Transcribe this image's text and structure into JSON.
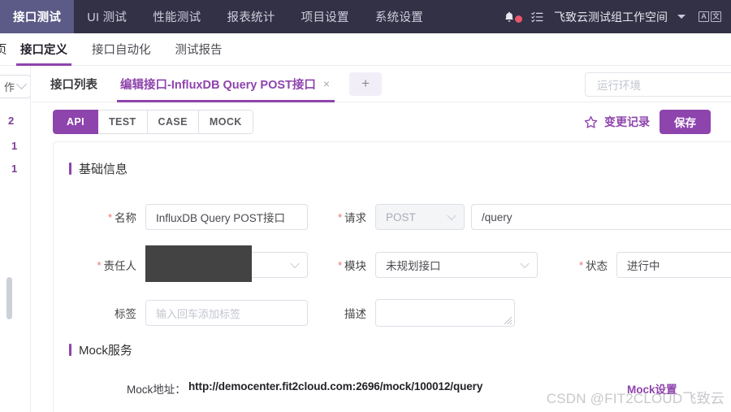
{
  "topbar": {
    "nav": [
      {
        "label": "接口测试",
        "active": true
      },
      {
        "label": "UI 测试",
        "active": false
      },
      {
        "label": "性能测试",
        "active": false
      },
      {
        "label": "报表统计",
        "active": false
      },
      {
        "label": "项目设置",
        "active": false
      },
      {
        "label": "系统设置",
        "active": false
      }
    ],
    "bell_icon": "bell-icon",
    "notification_dot": true,
    "tasklist_icon": "task-list-icon",
    "workspace": "飞致云测试组工作空间",
    "workspace_caret": "chevron-down-icon",
    "lang_toggle": [
      "A",
      "文"
    ]
  },
  "subnav": {
    "clipped_prefix": "页",
    "items": [
      {
        "label": "接口定义",
        "active": true
      },
      {
        "label": "接口自动化",
        "active": false
      },
      {
        "label": "测试报告",
        "active": false
      }
    ]
  },
  "sidebar": {
    "select_text": "作",
    "counts": [
      "2",
      "1",
      "1"
    ]
  },
  "tabs": {
    "items": [
      {
        "label": "接口列表",
        "active": false,
        "closable": false
      },
      {
        "label": "编辑接口-InfluxDB Query POST接口",
        "active": true,
        "closable": true
      }
    ],
    "close_glyph": "×",
    "add_label": "+",
    "add_icon": "plus-icon"
  },
  "environment": {
    "placeholder": "运行环境",
    "value": ""
  },
  "modes": {
    "items": [
      {
        "label": "API",
        "active": true
      },
      {
        "label": "TEST",
        "active": false
      },
      {
        "label": "CASE",
        "active": false
      },
      {
        "label": "MOCK",
        "active": false
      }
    ]
  },
  "actions": {
    "star_icon": "star-outline-icon",
    "changelog_label": "变更记录",
    "save_label": "保存"
  },
  "basic_info": {
    "title": "基础信息",
    "name_label": "名称",
    "name_value": "InfluxDB Query POST接口",
    "method_label": "请求",
    "method_value": "POST",
    "path_value": "/query",
    "owner_label": "责任人",
    "owner_value": "",
    "owner_redacted": true,
    "module_label": "模块",
    "module_value": "未规划接口",
    "status_label": "状态",
    "status_value": "进行中",
    "tag_label": "标签",
    "tag_placeholder": "输入回车添加标签",
    "desc_label": "描述",
    "desc_value": ""
  },
  "mock": {
    "title": "Mock服务",
    "address_label": "Mock地址：",
    "address_value": "http://democenter.fit2cloud.com:2696/mock/100012/query",
    "setting_label": "Mock设置"
  },
  "watermark": {
    "text": "CSDN @FIT2CLOUD飞致云"
  },
  "colors": {
    "header_bg": "#323145",
    "header_active_bg": "#5c5a86",
    "accent": "#8e44ad",
    "danger": "#f56c6c",
    "notification": "#e8566a"
  }
}
